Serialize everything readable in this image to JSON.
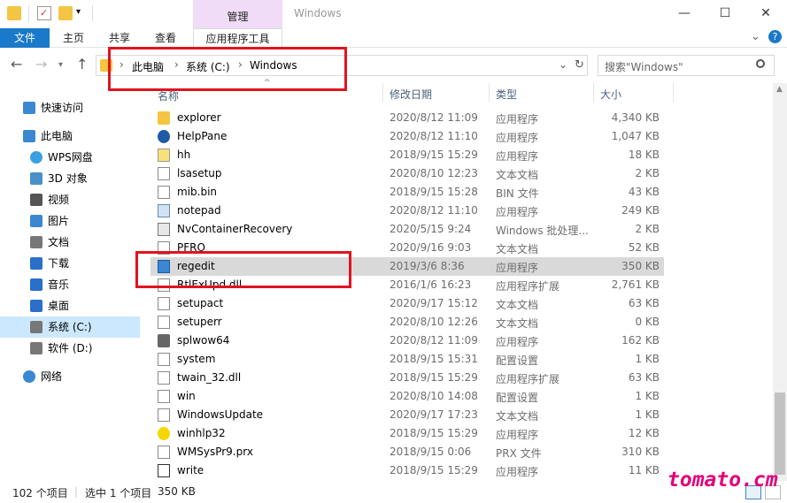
{
  "window": {
    "title": "Windows",
    "manage_tab": "管理",
    "min": "—",
    "max": "☐",
    "close": "✕",
    "chevron": "⌄",
    "help": "?"
  },
  "ribbon": {
    "tabs": [
      "文件",
      "主页",
      "共享",
      "查看",
      "应用程序工具"
    ]
  },
  "address": {
    "crumbs": [
      "此电脑",
      "系统 (C:)",
      "Windows"
    ],
    "dropdown": "⌄",
    "refresh": "↻"
  },
  "search": {
    "placeholder": "搜索\"Windows\""
  },
  "nav": {
    "items": [
      {
        "label": "快速访问",
        "icon": "star-icon"
      },
      {
        "label": "此电脑",
        "icon": "computer-icon"
      },
      {
        "label": "WPS网盘",
        "icon": "cloud-icon"
      },
      {
        "label": "3D 对象",
        "icon": "cube-icon"
      },
      {
        "label": "视频",
        "icon": "video-icon"
      },
      {
        "label": "图片",
        "icon": "picture-icon"
      },
      {
        "label": "文档",
        "icon": "document-icon"
      },
      {
        "label": "下载",
        "icon": "download-icon"
      },
      {
        "label": "音乐",
        "icon": "music-icon"
      },
      {
        "label": "桌面",
        "icon": "desktop-icon"
      },
      {
        "label": "系统 (C:)",
        "icon": "drive-icon"
      },
      {
        "label": "软件 (D:)",
        "icon": "drive-icon"
      },
      {
        "label": "网络",
        "icon": "network-icon"
      }
    ]
  },
  "columns": {
    "name": "名称",
    "date": "修改日期",
    "type": "类型",
    "size": "大小"
  },
  "files": [
    {
      "name": "explorer",
      "date": "2020/8/12 11:09",
      "type": "应用程序",
      "size": "4,340 KB",
      "icon": "folder-app-icon"
    },
    {
      "name": "HelpPane",
      "date": "2020/8/12 11:10",
      "type": "应用程序",
      "size": "1,047 KB",
      "icon": "help-icon"
    },
    {
      "name": "hh",
      "date": "2018/9/15 15:29",
      "type": "应用程序",
      "size": "18 KB",
      "icon": "help-file-icon"
    },
    {
      "name": "lsasetup",
      "date": "2020/8/10 12:23",
      "type": "文本文档",
      "size": "2 KB",
      "icon": "text-file-icon"
    },
    {
      "name": "mib.bin",
      "date": "2018/9/15 15:28",
      "type": "BIN 文件",
      "size": "43 KB",
      "icon": "file-icon"
    },
    {
      "name": "notepad",
      "date": "2020/8/12 11:10",
      "type": "应用程序",
      "size": "249 KB",
      "icon": "notepad-icon"
    },
    {
      "name": "NvContainerRecovery",
      "date": "2020/5/15 9:24",
      "type": "Windows 批处理...",
      "size": "2 KB",
      "icon": "batch-icon"
    },
    {
      "name": "PFRO",
      "date": "2020/9/16 9:03",
      "type": "文本文档",
      "size": "52 KB",
      "icon": "text-file-icon"
    },
    {
      "name": "regedit",
      "date": "2019/3/6 8:36",
      "type": "应用程序",
      "size": "350 KB",
      "icon": "regedit-icon"
    },
    {
      "name": "RtlExUpd.dll",
      "date": "2016/1/6 16:23",
      "type": "应用程序扩展",
      "size": "2,761 KB",
      "icon": "dll-icon"
    },
    {
      "name": "setupact",
      "date": "2020/9/17 15:12",
      "type": "文本文档",
      "size": "63 KB",
      "icon": "text-file-icon"
    },
    {
      "name": "setuperr",
      "date": "2020/8/10 12:26",
      "type": "文本文档",
      "size": "0 KB",
      "icon": "text-file-icon"
    },
    {
      "name": "splwow64",
      "date": "2020/8/12 11:09",
      "type": "应用程序",
      "size": "162 KB",
      "icon": "printer-icon"
    },
    {
      "name": "system",
      "date": "2018/9/15 15:31",
      "type": "配置设置",
      "size": "1 KB",
      "icon": "config-icon"
    },
    {
      "name": "twain_32.dll",
      "date": "2018/9/15 15:29",
      "type": "应用程序扩展",
      "size": "63 KB",
      "icon": "dll-icon"
    },
    {
      "name": "win",
      "date": "2020/8/10 14:08",
      "type": "配置设置",
      "size": "1 KB",
      "icon": "config-icon"
    },
    {
      "name": "WindowsUpdate",
      "date": "2020/9/17 17:23",
      "type": "文本文档",
      "size": "1 KB",
      "icon": "text-file-icon"
    },
    {
      "name": "winhlp32",
      "date": "2018/9/15 15:29",
      "type": "应用程序",
      "size": "12 KB",
      "icon": "help-app-icon"
    },
    {
      "name": "WMSysPr9.prx",
      "date": "2018/9/15 0:06",
      "type": "PRX 文件",
      "size": "310 KB",
      "icon": "file-icon"
    },
    {
      "name": "write",
      "date": "2018/9/15 15:29",
      "type": "应用程序",
      "size": "11 KB",
      "icon": "write-icon"
    }
  ],
  "selected_index": 8,
  "status": {
    "count": "102 个项目",
    "selected": "选中 1 个项目",
    "size": "350 KB"
  },
  "watermark": "tomato.cm",
  "colors": {
    "accent": "#1979ca",
    "manage": "#f0dcf6",
    "highlight": "#e0141f",
    "selected_row": "#d9d9d9",
    "watermark": "#e40079"
  }
}
